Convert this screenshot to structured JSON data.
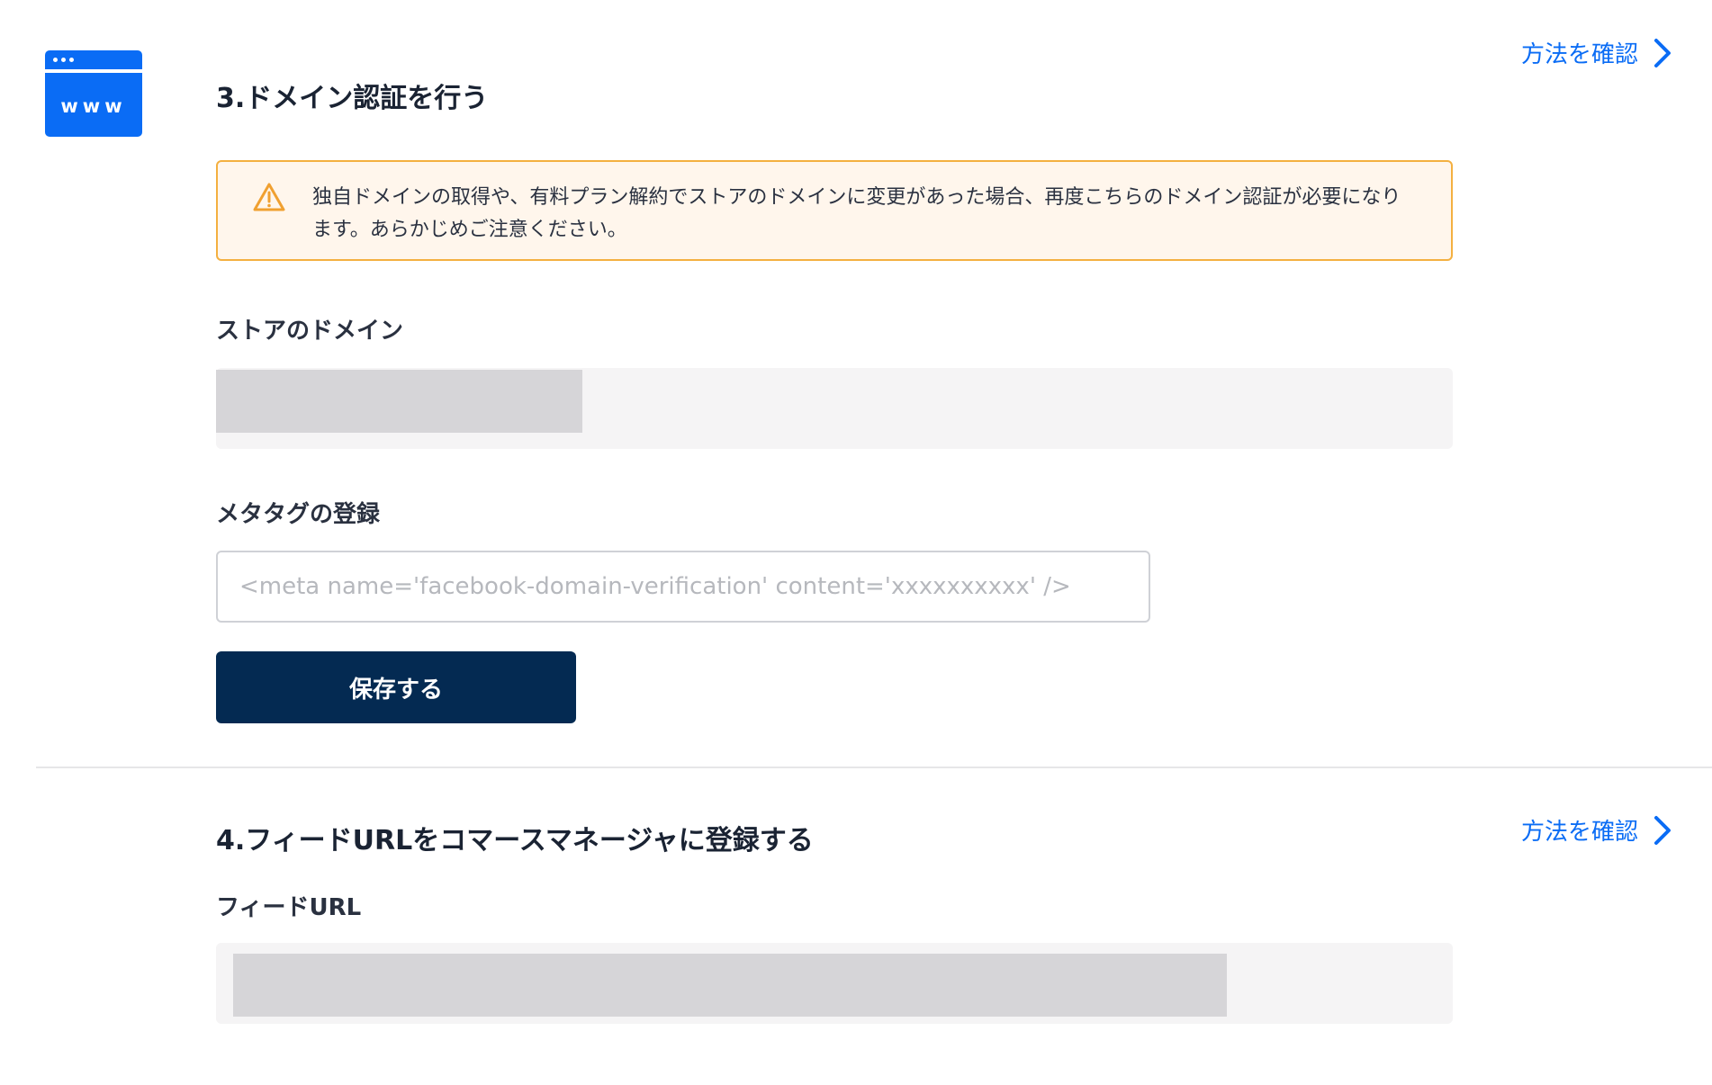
{
  "section3": {
    "icon_label": "www",
    "icon_name": "browser-www-icon",
    "title": "3.ドメイン認証を行う",
    "how_link": "方法を確認",
    "warning": {
      "icon_name": "warning-triangle-icon",
      "text": "独自ドメインの取得や、有料プラン解約でストアのドメインに変更があった場合、再度こちらのドメイン認証が必要になります。あらかじめご注意ください。"
    },
    "domain_label": "ストアのドメイン",
    "meta_label": "メタタグの登録",
    "meta_placeholder": "<meta name='facebook-domain-verification' content='xxxxxxxxxx' />",
    "meta_value": "",
    "save_label": "保存する"
  },
  "section4": {
    "title": "4.フィードURLをコマースマネージャに登録する",
    "how_link": "方法を確認",
    "feed_label": "フィードURL"
  },
  "colors": {
    "accent": "#0a6cf5",
    "button": "#042a52",
    "warning_border": "#f4b040",
    "warning_bg": "#fff6ec",
    "readonly_bg": "#f5f4f5",
    "redacted": "#d6d5d8"
  }
}
